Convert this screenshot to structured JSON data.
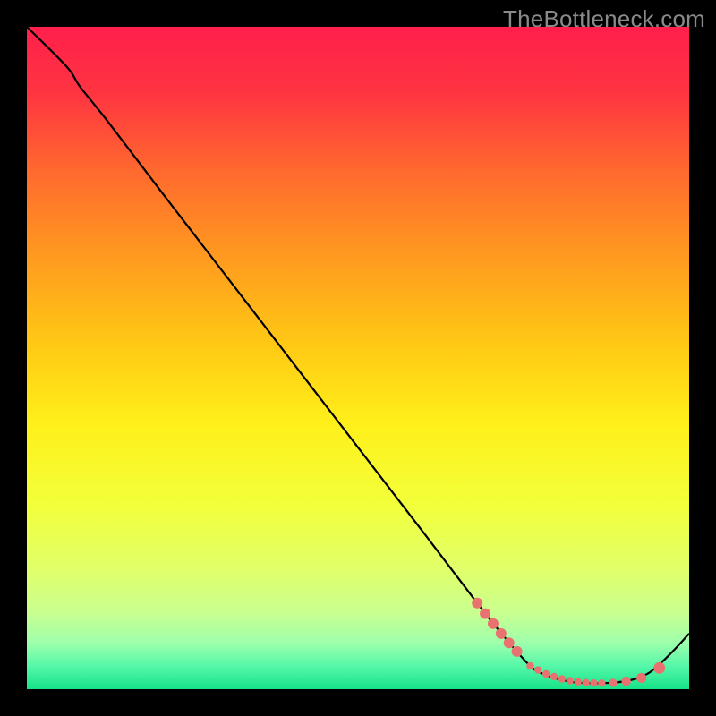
{
  "watermark": "TheBottleneck.com",
  "chart_data": {
    "type": "line",
    "title": "",
    "xlabel": "",
    "ylabel": "",
    "xlim": [
      0,
      100
    ],
    "ylim": [
      0,
      100
    ],
    "grid": false,
    "series": [
      {
        "name": "curve",
        "x": [
          0,
          6,
          8,
          12,
          20,
          30,
          40,
          50,
          60,
          68,
          72,
          76,
          78,
          80,
          82,
          84,
          86,
          88,
          90,
          92,
          94,
          96,
          98,
          100
        ],
        "y": [
          100,
          94,
          91,
          86,
          75.5,
          62.5,
          49.5,
          36.5,
          23.5,
          13,
          8,
          3.5,
          2.3,
          1.6,
          1.15,
          0.95,
          0.9,
          0.95,
          1.15,
          1.6,
          2.5,
          4.2,
          6.2,
          8.4
        ]
      }
    ],
    "markers": {
      "name": "points",
      "x": [
        68.0,
        69.2,
        70.4,
        71.6,
        72.8,
        74.0,
        76.0,
        77.2,
        78.4,
        79.6,
        80.8,
        82.0,
        83.2,
        84.4,
        85.6,
        86.8,
        88.5,
        90.5,
        92.8,
        95.5
      ],
      "y": [
        13.0,
        11.4,
        9.9,
        8.4,
        7.0,
        5.7,
        3.5,
        2.9,
        2.3,
        1.9,
        1.55,
        1.28,
        1.1,
        0.98,
        0.92,
        0.9,
        0.95,
        1.2,
        1.7,
        3.2
      ],
      "r": [
        6.0,
        6.0,
        6.0,
        6.0,
        6.0,
        6.0,
        4.2,
        4.2,
        4.2,
        4.2,
        4.2,
        4.2,
        4.2,
        4.2,
        4.2,
        4.2,
        4.6,
        5.2,
        5.6,
        6.4
      ]
    },
    "gradient_stops": [
      {
        "offset": 0.0,
        "color": "#ff1f4b"
      },
      {
        "offset": 0.1,
        "color": "#ff3441"
      },
      {
        "offset": 0.22,
        "color": "#ff6a2e"
      },
      {
        "offset": 0.35,
        "color": "#ff9b1f"
      },
      {
        "offset": 0.48,
        "color": "#ffc914"
      },
      {
        "offset": 0.6,
        "color": "#fff01a"
      },
      {
        "offset": 0.72,
        "color": "#f2ff3a"
      },
      {
        "offset": 0.82,
        "color": "#e0ff6a"
      },
      {
        "offset": 0.885,
        "color": "#c9ff90"
      },
      {
        "offset": 0.93,
        "color": "#9effac"
      },
      {
        "offset": 0.965,
        "color": "#55f7a8"
      },
      {
        "offset": 1.0,
        "color": "#17e389"
      }
    ],
    "curve_color": "#000000",
    "marker_color": "#e9716f"
  }
}
